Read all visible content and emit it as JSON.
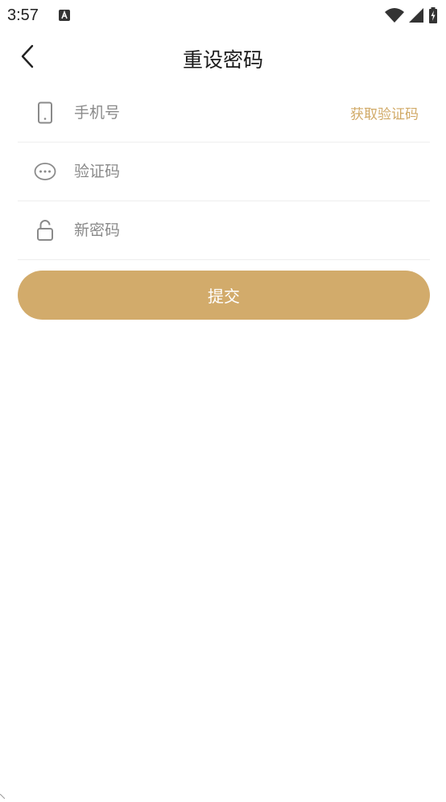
{
  "status_bar": {
    "time": "3:57",
    "icons": [
      "a-notification-icon",
      "wifi-icon",
      "signal-icon",
      "battery-charging-icon"
    ]
  },
  "header": {
    "title": "重设密码",
    "back_icon": "chevron-left-icon"
  },
  "form": {
    "phone": {
      "icon": "phone-icon",
      "placeholder": "手机号",
      "value": ""
    },
    "get_code_label": "获取验证码",
    "code": {
      "icon": "message-dots-icon",
      "placeholder": "验证码",
      "value": ""
    },
    "new_password": {
      "icon": "unlock-icon",
      "placeholder": "新密码",
      "value": ""
    }
  },
  "submit_label": "提交",
  "colors": {
    "accent": "#d2ab6b",
    "link": "#d1aa67",
    "divider": "#eeeeee",
    "icon": "#8a8a8a"
  }
}
